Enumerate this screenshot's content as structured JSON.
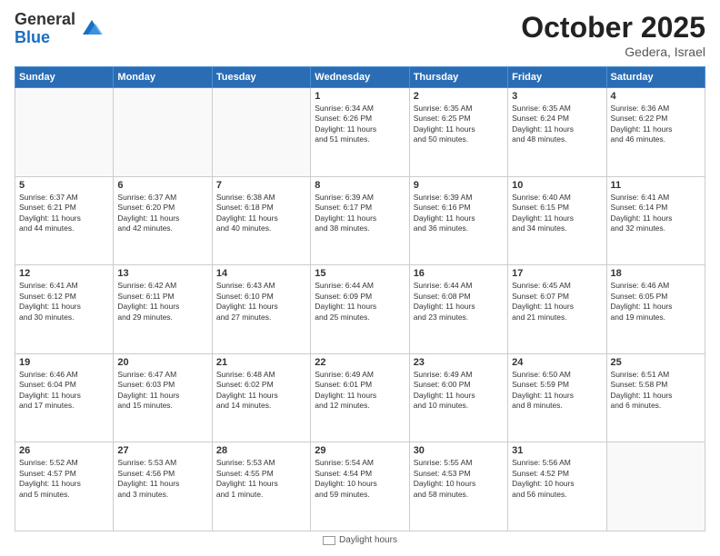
{
  "header": {
    "logo_general": "General",
    "logo_blue": "Blue",
    "title": "October 2025",
    "location": "Gedera, Israel"
  },
  "weekdays": [
    "Sunday",
    "Monday",
    "Tuesday",
    "Wednesday",
    "Thursday",
    "Friday",
    "Saturday"
  ],
  "weeks": [
    [
      {
        "day": "",
        "info": ""
      },
      {
        "day": "",
        "info": ""
      },
      {
        "day": "",
        "info": ""
      },
      {
        "day": "1",
        "info": "Sunrise: 6:34 AM\nSunset: 6:26 PM\nDaylight: 11 hours\nand 51 minutes."
      },
      {
        "day": "2",
        "info": "Sunrise: 6:35 AM\nSunset: 6:25 PM\nDaylight: 11 hours\nand 50 minutes."
      },
      {
        "day": "3",
        "info": "Sunrise: 6:35 AM\nSunset: 6:24 PM\nDaylight: 11 hours\nand 48 minutes."
      },
      {
        "day": "4",
        "info": "Sunrise: 6:36 AM\nSunset: 6:22 PM\nDaylight: 11 hours\nand 46 minutes."
      }
    ],
    [
      {
        "day": "5",
        "info": "Sunrise: 6:37 AM\nSunset: 6:21 PM\nDaylight: 11 hours\nand 44 minutes."
      },
      {
        "day": "6",
        "info": "Sunrise: 6:37 AM\nSunset: 6:20 PM\nDaylight: 11 hours\nand 42 minutes."
      },
      {
        "day": "7",
        "info": "Sunrise: 6:38 AM\nSunset: 6:18 PM\nDaylight: 11 hours\nand 40 minutes."
      },
      {
        "day": "8",
        "info": "Sunrise: 6:39 AM\nSunset: 6:17 PM\nDaylight: 11 hours\nand 38 minutes."
      },
      {
        "day": "9",
        "info": "Sunrise: 6:39 AM\nSunset: 6:16 PM\nDaylight: 11 hours\nand 36 minutes."
      },
      {
        "day": "10",
        "info": "Sunrise: 6:40 AM\nSunset: 6:15 PM\nDaylight: 11 hours\nand 34 minutes."
      },
      {
        "day": "11",
        "info": "Sunrise: 6:41 AM\nSunset: 6:14 PM\nDaylight: 11 hours\nand 32 minutes."
      }
    ],
    [
      {
        "day": "12",
        "info": "Sunrise: 6:41 AM\nSunset: 6:12 PM\nDaylight: 11 hours\nand 30 minutes."
      },
      {
        "day": "13",
        "info": "Sunrise: 6:42 AM\nSunset: 6:11 PM\nDaylight: 11 hours\nand 29 minutes."
      },
      {
        "day": "14",
        "info": "Sunrise: 6:43 AM\nSunset: 6:10 PM\nDaylight: 11 hours\nand 27 minutes."
      },
      {
        "day": "15",
        "info": "Sunrise: 6:44 AM\nSunset: 6:09 PM\nDaylight: 11 hours\nand 25 minutes."
      },
      {
        "day": "16",
        "info": "Sunrise: 6:44 AM\nSunset: 6:08 PM\nDaylight: 11 hours\nand 23 minutes."
      },
      {
        "day": "17",
        "info": "Sunrise: 6:45 AM\nSunset: 6:07 PM\nDaylight: 11 hours\nand 21 minutes."
      },
      {
        "day": "18",
        "info": "Sunrise: 6:46 AM\nSunset: 6:05 PM\nDaylight: 11 hours\nand 19 minutes."
      }
    ],
    [
      {
        "day": "19",
        "info": "Sunrise: 6:46 AM\nSunset: 6:04 PM\nDaylight: 11 hours\nand 17 minutes."
      },
      {
        "day": "20",
        "info": "Sunrise: 6:47 AM\nSunset: 6:03 PM\nDaylight: 11 hours\nand 15 minutes."
      },
      {
        "day": "21",
        "info": "Sunrise: 6:48 AM\nSunset: 6:02 PM\nDaylight: 11 hours\nand 14 minutes."
      },
      {
        "day": "22",
        "info": "Sunrise: 6:49 AM\nSunset: 6:01 PM\nDaylight: 11 hours\nand 12 minutes."
      },
      {
        "day": "23",
        "info": "Sunrise: 6:49 AM\nSunset: 6:00 PM\nDaylight: 11 hours\nand 10 minutes."
      },
      {
        "day": "24",
        "info": "Sunrise: 6:50 AM\nSunset: 5:59 PM\nDaylight: 11 hours\nand 8 minutes."
      },
      {
        "day": "25",
        "info": "Sunrise: 6:51 AM\nSunset: 5:58 PM\nDaylight: 11 hours\nand 6 minutes."
      }
    ],
    [
      {
        "day": "26",
        "info": "Sunrise: 5:52 AM\nSunset: 4:57 PM\nDaylight: 11 hours\nand 5 minutes."
      },
      {
        "day": "27",
        "info": "Sunrise: 5:53 AM\nSunset: 4:56 PM\nDaylight: 11 hours\nand 3 minutes."
      },
      {
        "day": "28",
        "info": "Sunrise: 5:53 AM\nSunset: 4:55 PM\nDaylight: 11 hours\nand 1 minute."
      },
      {
        "day": "29",
        "info": "Sunrise: 5:54 AM\nSunset: 4:54 PM\nDaylight: 10 hours\nand 59 minutes."
      },
      {
        "day": "30",
        "info": "Sunrise: 5:55 AM\nSunset: 4:53 PM\nDaylight: 10 hours\nand 58 minutes."
      },
      {
        "day": "31",
        "info": "Sunrise: 5:56 AM\nSunset: 4:52 PM\nDaylight: 10 hours\nand 56 minutes."
      },
      {
        "day": "",
        "info": ""
      }
    ]
  ],
  "footer": {
    "legend_label": "Daylight hours"
  }
}
